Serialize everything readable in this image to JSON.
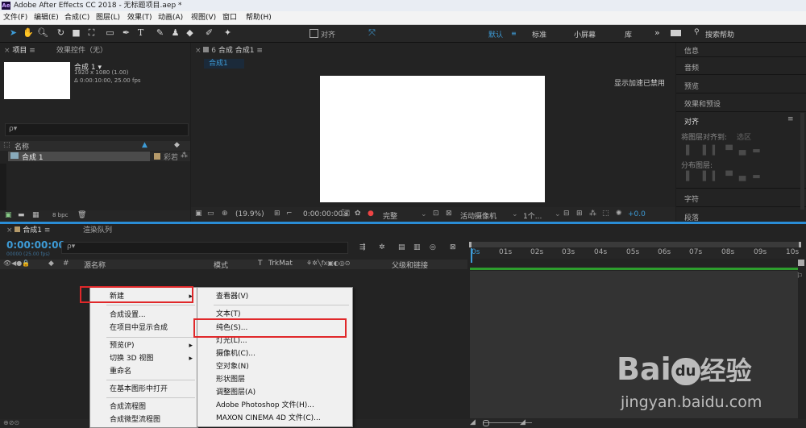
{
  "titlebar": {
    "app_icon": "Ae",
    "title": "Adobe After Effects CC 2018 - 无标题项目.aep *"
  },
  "menubar": [
    "文件(F)",
    "编辑(E)",
    "合成(C)",
    "图层(L)",
    "效果(T)",
    "动画(A)",
    "视图(V)",
    "窗口",
    "帮助(H)"
  ],
  "toolbar": {
    "snap_label": "对齐",
    "workspaces": [
      "默认",
      "标准",
      "小屏幕",
      "库"
    ],
    "search_label": "搜索帮助",
    "overflow": "»"
  },
  "project_panel": {
    "tab_project": "项目",
    "tab_effects": "效果控件（无）",
    "comp_name": "合成 1 ▾",
    "comp_info1": "1920 x 1080 (1.00)",
    "comp_info2": "Δ 0:00:10:00, 25.00 fps",
    "search_glyph": "ρ▾",
    "col_name": "名称",
    "item_name": "合成 1",
    "item_type": "彩若",
    "bpc": "8 bpc"
  },
  "comp_panel": {
    "tab_label": "合成 合成1",
    "sub_tab": "合成1",
    "gpu_notice": "显示加速已禁用",
    "zoom": "(19.9%)",
    "timecode": "0:00:00:00",
    "quality": "完整",
    "camera": "活动摄像机",
    "views": "1个...",
    "offset": "+0.0"
  },
  "right_panel": {
    "items": [
      "信息",
      "音频",
      "预览",
      "效果和预设"
    ],
    "align_header": "对齐",
    "align_to_label": "将图层对齐到:",
    "align_to_value": "选区",
    "distribute_label": "分布图层:",
    "items2": [
      "字符",
      "段落"
    ]
  },
  "timeline": {
    "tab_comp": "合成1",
    "tab_render": "渲染队列",
    "timecode": "0:00:00:00",
    "frame_info": "00000 (25.00 fps)",
    "search_glyph": "ρ▾",
    "col_name": "源名称",
    "col_mode": "模式",
    "col_t": "T",
    "col_trkmat": "TrkMat",
    "col_parent": "父级和链接",
    "ruler": [
      "0s",
      "01s",
      "02s",
      "03s",
      "04s",
      "05s",
      "06s",
      "07s",
      "08s",
      "09s",
      "10s"
    ]
  },
  "context_menu": {
    "items": [
      "新建",
      "合成设置...",
      "在项目中显示合成",
      "预览(P)",
      "切换 3D 视图",
      "重命名",
      "在基本图形中打开",
      "合成流程图",
      "合成微型流程图"
    ],
    "submenu": [
      "查看器(V)",
      "文本(T)",
      "纯色(S)...",
      "灯光(L)...",
      "摄像机(C)...",
      "空对象(N)",
      "形状图层",
      "调整图层(A)",
      "Adobe Photoshop 文件(H)...",
      "MAXON CINEMA 4D 文件(C)..."
    ]
  },
  "watermark": {
    "brand": "Bai",
    "paw": "du",
    "suffix": "经验",
    "url": "jingyan.baidu.com"
  },
  "colors": {
    "accent": "#3d9bd6",
    "highlight": "#e0282a",
    "panel": "#232323",
    "comp_label": "#b59a6a",
    "green_bar": "#2d9e2d"
  }
}
